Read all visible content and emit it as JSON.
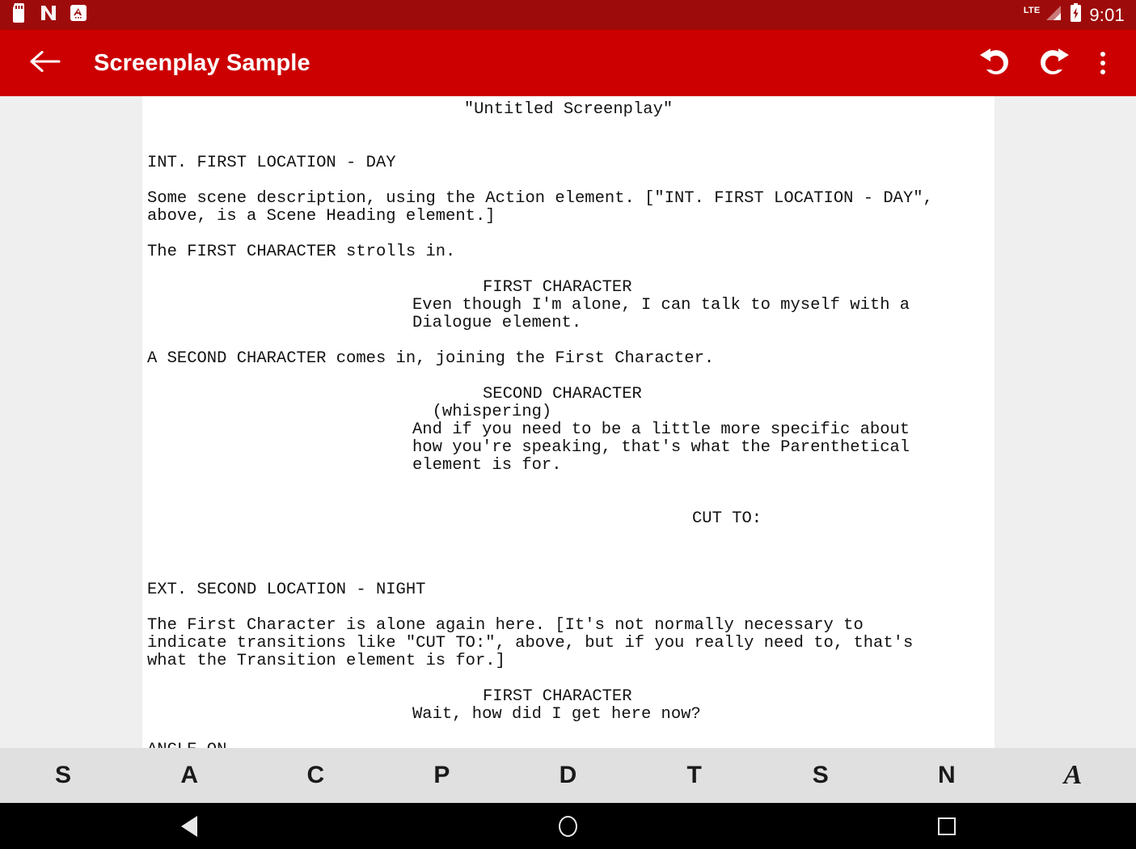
{
  "status_bar": {
    "notifications": [
      {
        "name": "sd-card-icon",
        "label": "SD"
      },
      {
        "name": "nova-launcher-icon",
        "label": "N"
      },
      {
        "name": "app-notification-icon",
        "label": "A"
      }
    ],
    "network_label": "LTE",
    "signal_icon": "signal-bars-icon",
    "battery_icon": "battery-charging-icon",
    "time": "9:01",
    "background_color": "#9e0b0b"
  },
  "app_bar": {
    "back_icon": "arrow-back-icon",
    "title": "Screenplay Sample",
    "undo_icon": "undo-icon",
    "redo_icon": "redo-icon",
    "overflow_icon": "more-vertical-icon",
    "background_color": "#cc0000"
  },
  "document": {
    "page_background": "#ffffff",
    "canvas_background": "#efeff0",
    "lines": [
      {
        "type": "title",
        "indent": "ctr",
        "text": "\"Untitled Screenplay\""
      },
      {
        "type": "blank",
        "indent": "c0",
        "text": ""
      },
      {
        "type": "blank",
        "indent": "c0",
        "text": ""
      },
      {
        "type": "scene-heading",
        "indent": "c0",
        "text": "INT. FIRST LOCATION - DAY"
      },
      {
        "type": "blank",
        "indent": "c0",
        "text": ""
      },
      {
        "type": "action",
        "indent": "c0",
        "text": "Some scene description, using the Action element. [\"INT. FIRST LOCATION - DAY\","
      },
      {
        "type": "action",
        "indent": "c0",
        "text": "above, is a Scene Heading element.]"
      },
      {
        "type": "blank",
        "indent": "c0",
        "text": ""
      },
      {
        "type": "action",
        "indent": "c0",
        "text": "The FIRST CHARACTER strolls in."
      },
      {
        "type": "blank",
        "indent": "c0",
        "text": ""
      },
      {
        "type": "character",
        "indent": "c24",
        "text": "FIRST CHARACTER"
      },
      {
        "type": "dialogue",
        "indent": "c19",
        "text": "Even though I'm alone, I can talk to myself with a"
      },
      {
        "type": "dialogue",
        "indent": "c19",
        "text": "Dialogue element."
      },
      {
        "type": "blank",
        "indent": "c0",
        "text": ""
      },
      {
        "type": "action",
        "indent": "c0",
        "text": "A SECOND CHARACTER comes in, joining the First Character."
      },
      {
        "type": "blank",
        "indent": "c0",
        "text": ""
      },
      {
        "type": "character",
        "indent": "c24",
        "text": "SECOND CHARACTER"
      },
      {
        "type": "parenthetical",
        "indent": "c19",
        "text": "  (whispering)"
      },
      {
        "type": "dialogue",
        "indent": "c19",
        "text": "And if you need to be a little more specific about"
      },
      {
        "type": "dialogue",
        "indent": "c19",
        "text": "how you're speaking, that's what the Parenthetical"
      },
      {
        "type": "dialogue",
        "indent": "c19",
        "text": "element is for."
      },
      {
        "type": "blank",
        "indent": "c0",
        "text": ""
      },
      {
        "type": "blank",
        "indent": "c0",
        "text": ""
      },
      {
        "type": "transition",
        "indent": "c39",
        "text": "CUT TO:"
      },
      {
        "type": "blank",
        "indent": "c0",
        "text": ""
      },
      {
        "type": "blank",
        "indent": "c0",
        "text": ""
      },
      {
        "type": "blank",
        "indent": "c0",
        "text": ""
      },
      {
        "type": "scene-heading",
        "indent": "c0",
        "text": "EXT. SECOND LOCATION - NIGHT"
      },
      {
        "type": "blank",
        "indent": "c0",
        "text": ""
      },
      {
        "type": "action",
        "indent": "c0",
        "text": "The First Character is alone again here. [It's not normally necessary to"
      },
      {
        "type": "action",
        "indent": "c0",
        "text": "indicate transitions like \"CUT TO:\", above, but if you really need to, that's"
      },
      {
        "type": "action",
        "indent": "c0",
        "text": "what the Transition element is for.]"
      },
      {
        "type": "blank",
        "indent": "c0",
        "text": ""
      },
      {
        "type": "character",
        "indent": "c24",
        "text": "FIRST CHARACTER"
      },
      {
        "type": "dialogue",
        "indent": "c19",
        "text": "Wait, how did I get here now?"
      },
      {
        "type": "blank",
        "indent": "c0",
        "text": ""
      },
      {
        "type": "scene-heading",
        "indent": "c0",
        "text": "ANGLE ON"
      }
    ]
  },
  "element_bar": {
    "background_color": "#e0e0e0",
    "buttons": [
      {
        "name": "element-scene-heading",
        "label": "S",
        "style": "sans"
      },
      {
        "name": "element-action",
        "label": "A",
        "style": "sans"
      },
      {
        "name": "element-character",
        "label": "C",
        "style": "sans"
      },
      {
        "name": "element-parenthetical",
        "label": "P",
        "style": "sans"
      },
      {
        "name": "element-dialogue",
        "label": "D",
        "style": "sans"
      },
      {
        "name": "element-transition",
        "label": "T",
        "style": "sans"
      },
      {
        "name": "element-shot",
        "label": "S",
        "style": "sans"
      },
      {
        "name": "element-note",
        "label": "N",
        "style": "sans"
      },
      {
        "name": "element-format",
        "label": "A",
        "style": "serif"
      }
    ]
  },
  "nav_bar": {
    "background_color": "#000000",
    "back_icon": "nav-back-icon",
    "home_icon": "nav-home-icon",
    "recents_icon": "nav-recents-icon"
  }
}
